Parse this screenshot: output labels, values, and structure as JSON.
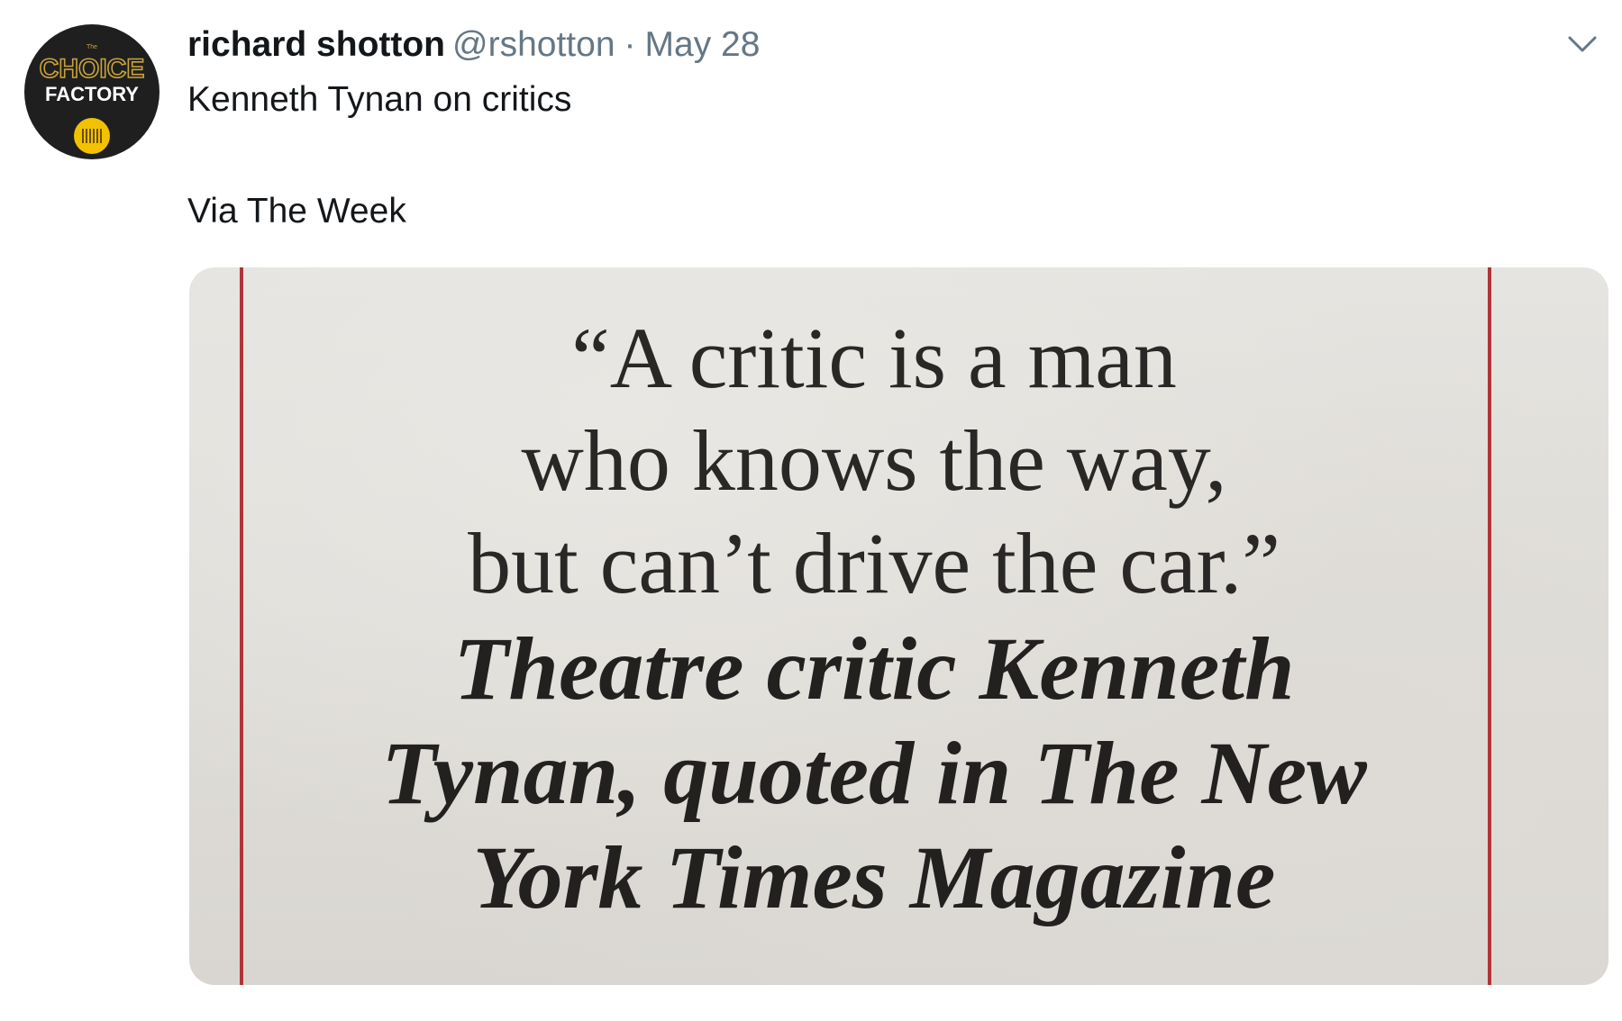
{
  "tweet": {
    "avatar": {
      "logo_the": "The",
      "logo_choice": "CHOICE",
      "logo_factory": "FACTORY",
      "icon": "barcode-badge-icon"
    },
    "author_name": "richard shotton",
    "author_handle": "@rshotton",
    "separator": "·",
    "date": "May 28",
    "menu_icon": "chevron-down-icon",
    "text_line_1": "Kenneth Tynan on critics",
    "text_line_2": "Via The Week",
    "media": {
      "quote_line_1": "“A critic is a man",
      "quote_line_2": "who knows the way,",
      "quote_line_3": "but can’t drive the car.”",
      "attribution_line_1": "Theatre critic Kenneth",
      "attribution_line_2": "Tynan, quoted in The New",
      "attribution_line_3": "York Times Magazine",
      "rule_color": "#b0353a"
    }
  },
  "colors": {
    "text_primary": "#14171a",
    "text_secondary": "#657786",
    "background": "#ffffff"
  }
}
